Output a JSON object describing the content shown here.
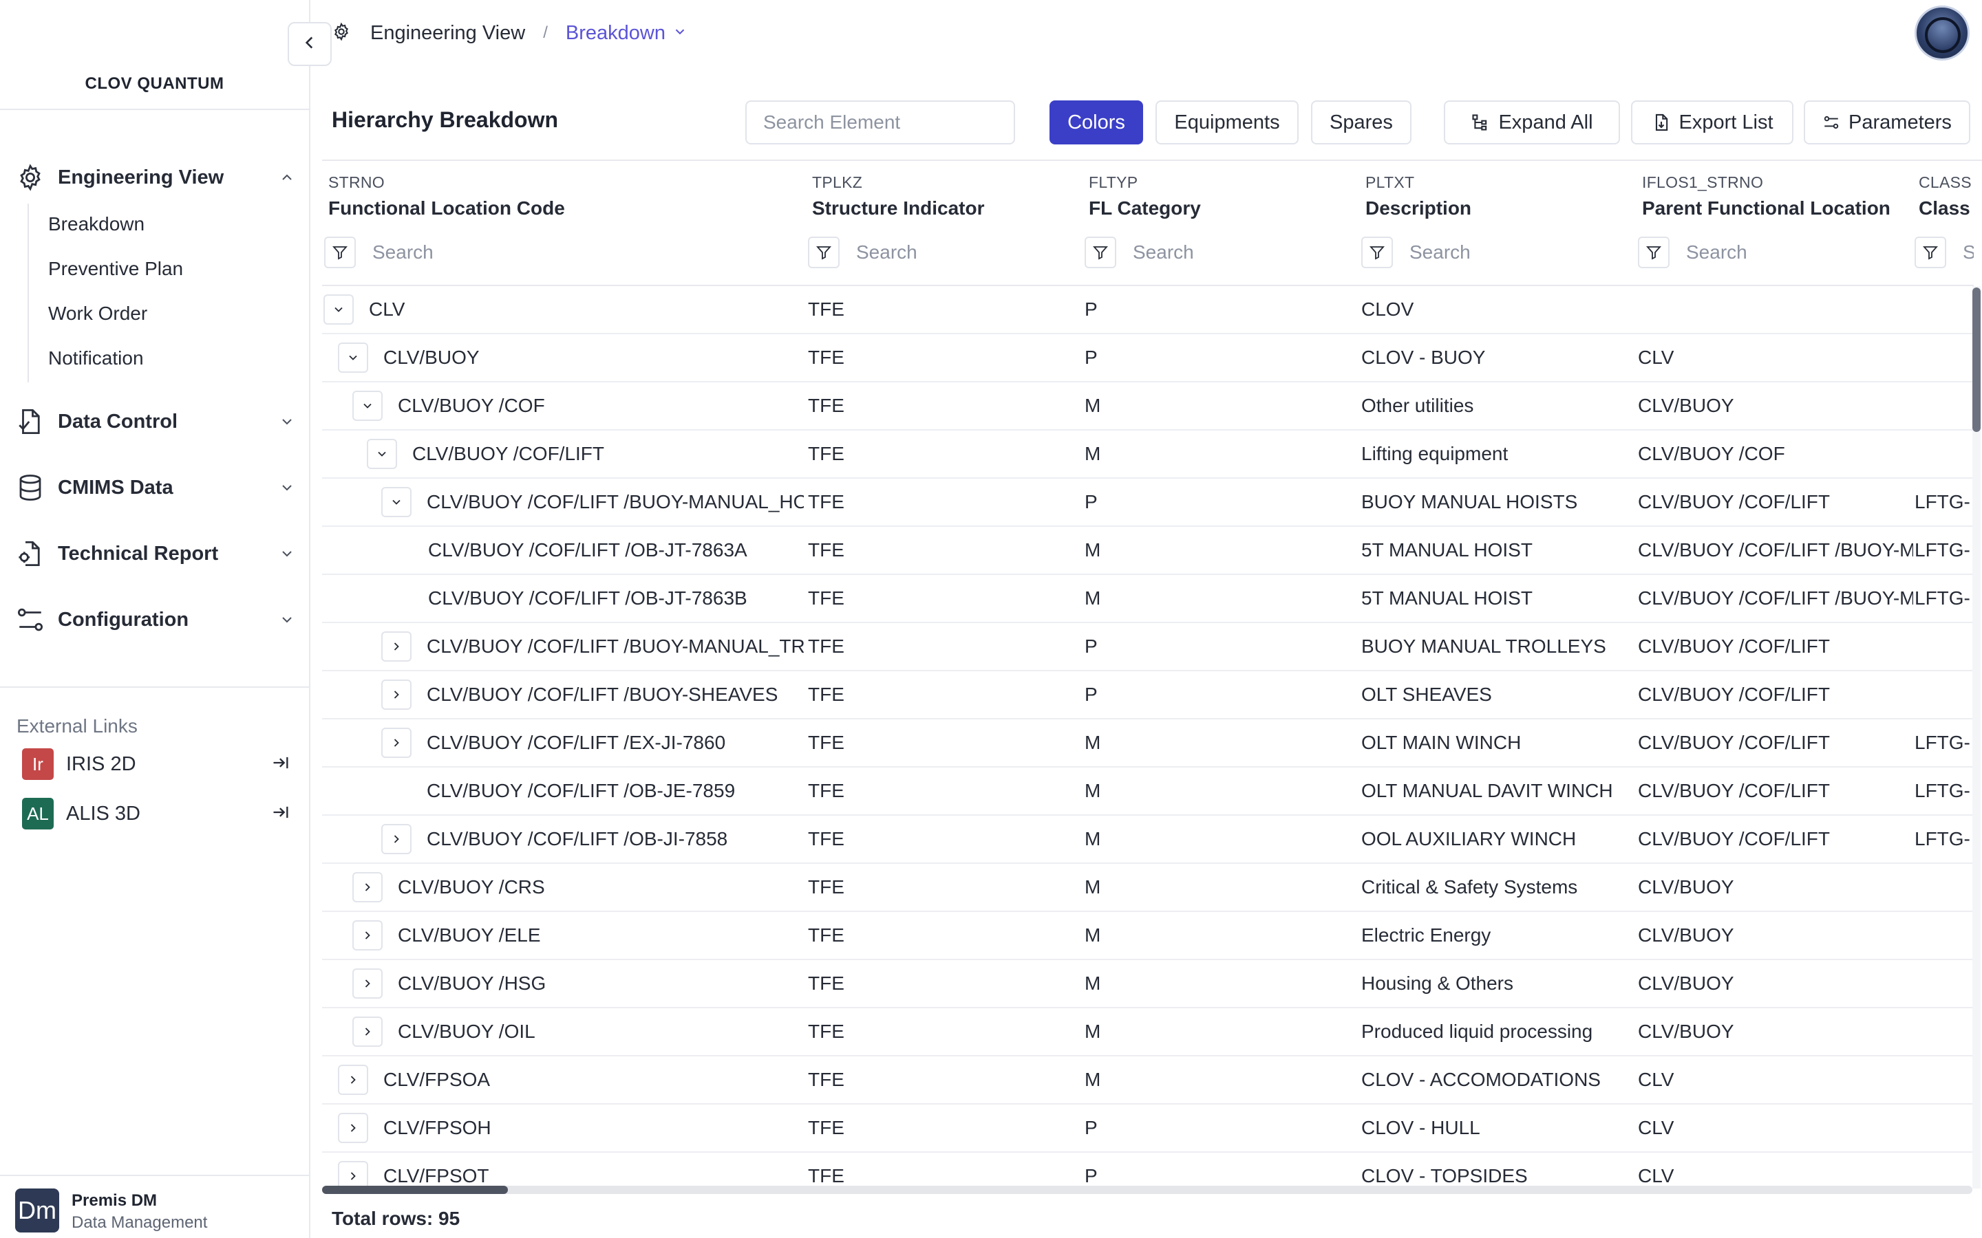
{
  "sidebar": {
    "brand": "CLOV QUANTUM",
    "sections": [
      {
        "label": "Engineering View",
        "icon": "gear-icon",
        "expanded": true
      },
      {
        "label": "Data Control",
        "icon": "document-check-icon",
        "expanded": false
      },
      {
        "label": "CMIMS Data",
        "icon": "database-icon",
        "expanded": false
      },
      {
        "label": "Technical Report",
        "icon": "report-gear-icon",
        "expanded": false
      },
      {
        "label": "Configuration",
        "icon": "sliders-icon",
        "expanded": false
      }
    ],
    "sub_items": [
      "Breakdown",
      "Preventive Plan",
      "Work Order",
      "Notification"
    ],
    "external_title": "External Links",
    "external_links": [
      {
        "badge": "Ir",
        "label": "IRIS 2D",
        "color": "#c44848"
      },
      {
        "badge": "AL",
        "label": "ALIS 3D",
        "color": "#1e6b54"
      }
    ],
    "user": {
      "avatar": "Dm",
      "name": "Premis DM",
      "role": "Data Management"
    }
  },
  "header": {
    "breadcrumb_home": "Engineering View",
    "breadcrumb_separator": "/",
    "breadcrumb_current": "Breakdown"
  },
  "toolbar": {
    "title": "Hierarchy Breakdown",
    "search_placeholder": "Search Element",
    "toggles": [
      "Colors",
      "Equipments",
      "Spares"
    ],
    "active_toggle": "Colors",
    "actions": [
      "Expand All",
      "Export List",
      "Parameters"
    ]
  },
  "colors": {
    "accent": "#3b3fc7",
    "link": "#5b54d6"
  },
  "table": {
    "columns": [
      {
        "code": "STRNO",
        "title": "Functional Location Code",
        "filter_placeholder": "Search"
      },
      {
        "code": "TPLKZ",
        "title": "Structure Indicator",
        "filter_placeholder": "Search"
      },
      {
        "code": "FLTYP",
        "title": "FL Category",
        "filter_placeholder": "Search"
      },
      {
        "code": "PLTXT",
        "title": "Description",
        "filter_placeholder": "Search"
      },
      {
        "code": "IFLOS1_STRNO",
        "title": "Parent Functional Location",
        "filter_placeholder": "Search"
      },
      {
        "code": "CLASS",
        "title": "Class",
        "filter_placeholder": "S"
      }
    ],
    "rows": [
      {
        "level": 0,
        "toggle": "expanded",
        "code": "CLV",
        "tplkz": "TFE",
        "fltyp": "P",
        "desc": "CLOV",
        "parent": "",
        "class": ""
      },
      {
        "level": 1,
        "toggle": "expanded",
        "code": "CLV/BUOY",
        "tplkz": "TFE",
        "fltyp": "P",
        "desc": "CLOV - BUOY",
        "parent": "CLV",
        "class": ""
      },
      {
        "level": 2,
        "toggle": "expanded",
        "code": "CLV/BUOY /COF",
        "tplkz": "TFE",
        "fltyp": "M",
        "desc": "Other utilities",
        "parent": "CLV/BUOY",
        "class": ""
      },
      {
        "level": 3,
        "toggle": "expanded",
        "code": "CLV/BUOY /COF/LIFT",
        "tplkz": "TFE",
        "fltyp": "M",
        "desc": "Lifting equipment",
        "parent": "CLV/BUOY /COF",
        "class": ""
      },
      {
        "level": 4,
        "toggle": "expanded",
        "code": "CLV/BUOY /COF/LIFT /BUOY-MANUAL_HOISTS",
        "tplkz": "TFE",
        "fltyp": "P",
        "desc": "BUOY MANUAL HOISTS",
        "parent": "CLV/BUOY /COF/LIFT",
        "class": "LFTG-"
      },
      {
        "level": 5,
        "toggle": "none",
        "code": "CLV/BUOY /COF/LIFT /OB-JT-7863A",
        "tplkz": "TFE",
        "fltyp": "M",
        "desc": "5T MANUAL HOIST",
        "parent": "CLV/BUOY /COF/LIFT /BUOY-MANUAL_HOISTS",
        "class": "LFTG-"
      },
      {
        "level": 5,
        "toggle": "none",
        "code": "CLV/BUOY /COF/LIFT /OB-JT-7863B",
        "tplkz": "TFE",
        "fltyp": "M",
        "desc": "5T MANUAL HOIST",
        "parent": "CLV/BUOY /COF/LIFT /BUOY-MANUAL_HOISTS",
        "class": "LFTG-"
      },
      {
        "level": 4,
        "toggle": "collapsed",
        "code": "CLV/BUOY /COF/LIFT /BUOY-MANUAL_TROLLEYS",
        "tplkz": "TFE",
        "fltyp": "P",
        "desc": "BUOY MANUAL TROLLEYS",
        "parent": "CLV/BUOY /COF/LIFT",
        "class": ""
      },
      {
        "level": 4,
        "toggle": "collapsed",
        "code": "CLV/BUOY /COF/LIFT /BUOY-SHEAVES",
        "tplkz": "TFE",
        "fltyp": "P",
        "desc": "OLT SHEAVES",
        "parent": "CLV/BUOY /COF/LIFT",
        "class": ""
      },
      {
        "level": 4,
        "toggle": "collapsed",
        "code": "CLV/BUOY /COF/LIFT /EX-JI-7860",
        "tplkz": "TFE",
        "fltyp": "M",
        "desc": "OLT MAIN WINCH",
        "parent": "CLV/BUOY /COF/LIFT",
        "class": "LFTG-"
      },
      {
        "level": 4,
        "toggle": "none",
        "code": "CLV/BUOY /COF/LIFT /OB-JE-7859",
        "tplkz": "TFE",
        "fltyp": "M",
        "desc": "OLT MANUAL DAVIT WINCH",
        "parent": "CLV/BUOY /COF/LIFT",
        "class": "LFTG-"
      },
      {
        "level": 4,
        "toggle": "collapsed",
        "code": "CLV/BUOY /COF/LIFT /OB-JI-7858",
        "tplkz": "TFE",
        "fltyp": "M",
        "desc": "OOL AUXILIARY WINCH",
        "parent": "CLV/BUOY /COF/LIFT",
        "class": "LFTG-"
      },
      {
        "level": 2,
        "toggle": "collapsed",
        "code": "CLV/BUOY /CRS",
        "tplkz": "TFE",
        "fltyp": "M",
        "desc": "Critical & Safety Systems",
        "parent": "CLV/BUOY",
        "class": ""
      },
      {
        "level": 2,
        "toggle": "collapsed",
        "code": "CLV/BUOY /ELE",
        "tplkz": "TFE",
        "fltyp": "M",
        "desc": "Electric Energy",
        "parent": "CLV/BUOY",
        "class": ""
      },
      {
        "level": 2,
        "toggle": "collapsed",
        "code": "CLV/BUOY /HSG",
        "tplkz": "TFE",
        "fltyp": "M",
        "desc": "Housing & Others",
        "parent": "CLV/BUOY",
        "class": ""
      },
      {
        "level": 2,
        "toggle": "collapsed",
        "code": "CLV/BUOY /OIL",
        "tplkz": "TFE",
        "fltyp": "M",
        "desc": "Produced liquid processing",
        "parent": "CLV/BUOY",
        "class": ""
      },
      {
        "level": 1,
        "toggle": "collapsed",
        "code": "CLV/FPSOA",
        "tplkz": "TFE",
        "fltyp": "M",
        "desc": "CLOV - ACCOMODATIONS",
        "parent": "CLV",
        "class": ""
      },
      {
        "level": 1,
        "toggle": "collapsed",
        "code": "CLV/FPSOH",
        "tplkz": "TFE",
        "fltyp": "P",
        "desc": "CLOV - HULL",
        "parent": "CLV",
        "class": ""
      },
      {
        "level": 1,
        "toggle": "collapsed",
        "code": "CLV/FPSOT",
        "tplkz": "TFE",
        "fltyp": "P",
        "desc": "CLOV - TOPSIDES",
        "parent": "CLV",
        "class": ""
      }
    ]
  },
  "footer": {
    "total_rows": "Total rows: 95"
  }
}
